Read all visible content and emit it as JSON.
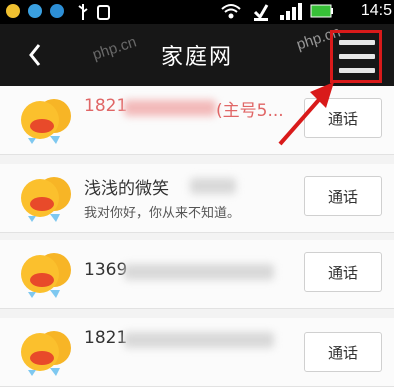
{
  "status_bar": {
    "time": "14:5",
    "icons": [
      "notification-app-icon",
      "notification-circle-icon",
      "notification-circle-icon",
      "usb-icon",
      "app-icon",
      "wifi-icon",
      "check-icon",
      "signal-icon",
      "battery-icon"
    ]
  },
  "header": {
    "title": "家庭网",
    "back_icon": "chevron-left-icon",
    "menu_icon": "hamburger-menu-icon",
    "watermark": "php.cn"
  },
  "contacts": [
    {
      "name": "1821",
      "name_suffix": "(主号5...",
      "note": "",
      "call_label": "通话",
      "primary": true
    },
    {
      "name": "浅浅的微笑",
      "name_suffix": "",
      "note": "我对你好，你从来不知道。",
      "call_label": "通话",
      "primary": false
    },
    {
      "name": "1369",
      "name_suffix": "",
      "note": "",
      "call_label": "通话",
      "primary": false
    },
    {
      "name": "1821",
      "name_suffix": "",
      "note": "",
      "call_label": "通话",
      "primary": false
    }
  ],
  "colors": {
    "header_bg": "#171717",
    "highlight": "#d91a1a",
    "primary_name": "#e06666"
  }
}
